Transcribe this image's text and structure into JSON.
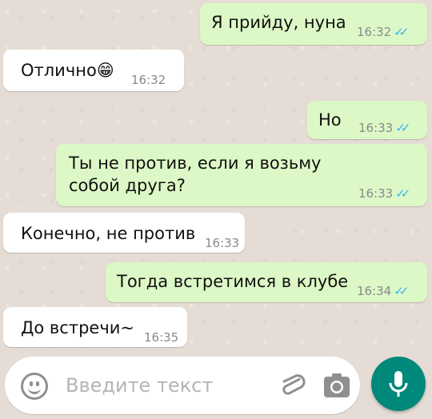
{
  "messages": [
    {
      "text": "Я прийду, нуна",
      "time": "16:32",
      "status": "read"
    },
    {
      "text": "Отлично",
      "emoji": "😁",
      "time": "16:32"
    },
    {
      "text": "Но",
      "time": "16:33",
      "status": "read"
    },
    {
      "text": "Ты не против, если я возьму собой друга?",
      "time": "16:33",
      "status": "read"
    },
    {
      "text": "Конечно, не против",
      "time": "16:33"
    },
    {
      "text": "Тогда встретимся в клубе",
      "time": "16:34",
      "status": "read"
    },
    {
      "text": "До встречи~",
      "time": "16:35"
    }
  ],
  "read_ticks": "✓✓",
  "input": {
    "placeholder": "Введите текст"
  },
  "icons": {
    "emoji": "emoji-icon",
    "attach": "paperclip-icon",
    "camera": "camera-icon",
    "mic": "microphone-icon"
  },
  "colors": {
    "outgoing_bubble": "#dcf8c6",
    "incoming_bubble": "#ffffff",
    "read_ticks": "#34b7f1",
    "mic_button": "#00897b"
  }
}
